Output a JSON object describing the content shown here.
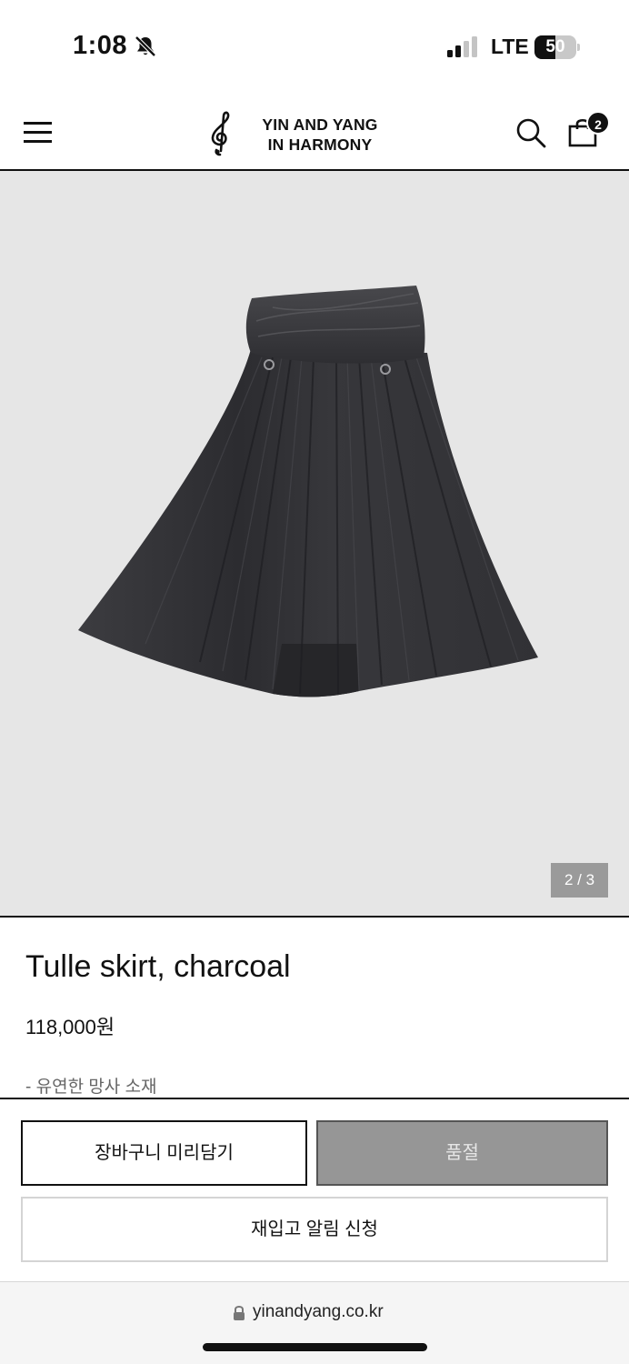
{
  "status_bar": {
    "time": "1:08",
    "network": "LTE",
    "battery_level": "50",
    "battery_fraction": 0.5,
    "bell_icon": "bell-muted-icon",
    "signal_icon": "cellular-signal-icon"
  },
  "header": {
    "logo_line1": "YIN AND YANG",
    "logo_line2": "IN HARMONY",
    "logo_icon": "treble-clef-icon",
    "menu_icon": "hamburger-menu-icon",
    "search_icon": "search-icon",
    "cart_icon": "shopping-bag-icon",
    "cart_count": "2"
  },
  "gallery": {
    "counter": "2 / 3"
  },
  "product": {
    "title": "Tulle skirt, charcoal",
    "price": "118,000원",
    "description": "- 유연한 망사 소재"
  },
  "actions": {
    "preorder_label": "장바구니 미리담기",
    "soldout_label": "품절",
    "restock_label": "재입고 알림 신청"
  },
  "browser": {
    "url": "yinandyang.co.kr",
    "lock_icon": "lock-icon"
  },
  "colors": {
    "background": "#ffffff",
    "image_background": "#e6e6e6",
    "text": "#111111",
    "muted_text": "#666666",
    "soldout_button": "#969696"
  }
}
